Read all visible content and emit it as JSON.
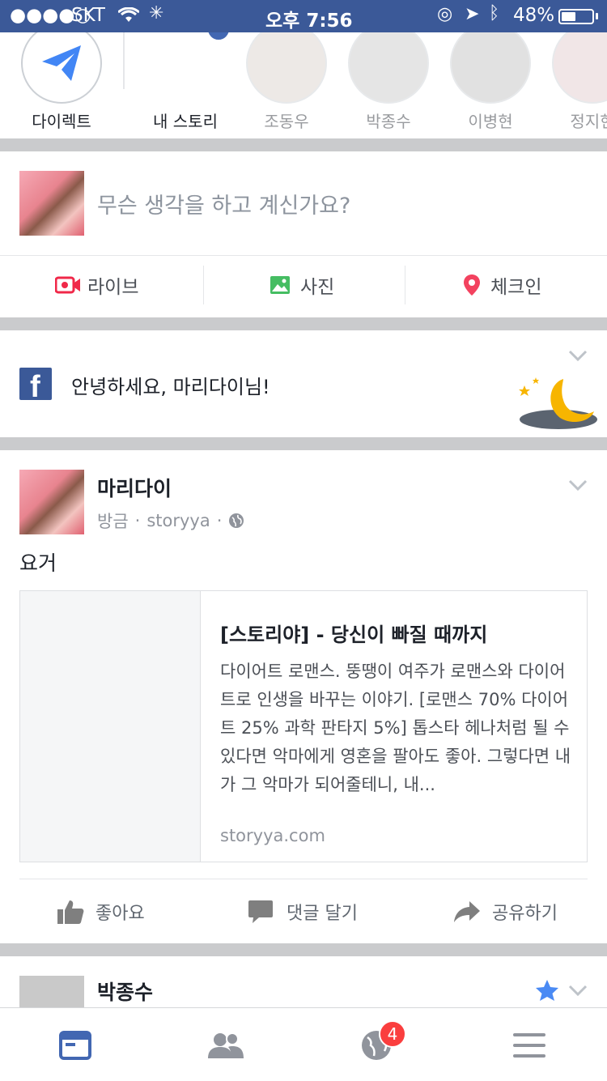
{
  "status_bar": {
    "carrier": "SKT",
    "time": "오후 7:56",
    "battery": "48%",
    "battery_level": 0.48
  },
  "stories": [
    {
      "name": "다이렉트"
    },
    {
      "name": "내 스토리"
    },
    {
      "name": "조동우"
    },
    {
      "name": "박종수"
    },
    {
      "name": "이병현"
    },
    {
      "name": "정지현"
    }
  ],
  "composer": {
    "placeholder": "무슨 생각을 하고 계신가요?",
    "actions": [
      {
        "label": "라이브",
        "icon": "live-video-icon",
        "color": "#f02849"
      },
      {
        "label": "사진",
        "icon": "photo-icon",
        "color": "#45bd62"
      },
      {
        "label": "체크인",
        "icon": "location-pin-icon",
        "color": "#f3425f"
      }
    ]
  },
  "greeting": {
    "text": "안녕하세요, 마리다이님!"
  },
  "post": {
    "author": "마리다이",
    "time": "방금",
    "via": "storyya",
    "body": "요거",
    "link": {
      "title": "[스토리야] - 당신이 빠질 때까지",
      "description": "다이어트 로맨스. 뚱땡이 여주가 로맨스와 다이어트로 인생을 바꾸는 이야기. [로맨스 70% 다이어트 25% 과학 판타지 5%] 톱스타 헤나처럼 될 수 있다면 악마에게 영혼을 팔아도 좋아. 그렇다면 내가 그 악마가 되어줄테니, 내...",
      "domain": "storyya.com"
    },
    "actions": {
      "like": "좋아요",
      "comment": "댓글 달기",
      "share": "공유하기"
    }
  },
  "next_post": {
    "author": "박종수"
  },
  "tab_bar": {
    "notifications_badge": "4"
  },
  "colors": {
    "brand": "#3b5998",
    "active_tab": "#4267b2",
    "badge": "#fa3e3e"
  }
}
